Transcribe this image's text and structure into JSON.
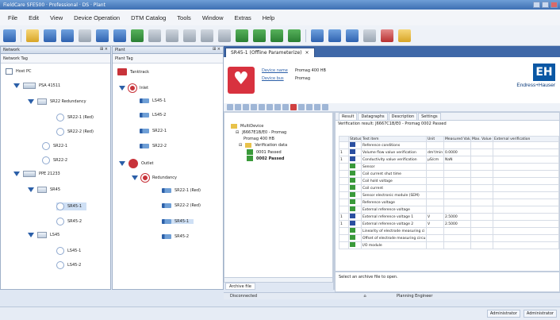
{
  "window": {
    "title": "FieldCare SFE500 · Professional · DS · Plant"
  },
  "menu": [
    "File",
    "Edit",
    "View",
    "Device Operation",
    "DTM Catalog",
    "Tools",
    "Window",
    "Extras",
    "Help"
  ],
  "network_panel": {
    "title": "Network",
    "pin": "⊞ ×",
    "column": "Network Tag",
    "items": [
      "Host PC",
      "PSA 41511",
      "SR22 Redundancy",
      "SR22-1 (Red)",
      "SR22-2 (Red)",
      "SR22-1",
      "SR22-2",
      "PPE 21233",
      "SR45",
      "SR45-1",
      "SR45-2",
      "LS45",
      "LS45-1",
      "LS45-2"
    ]
  },
  "plant_panel": {
    "title": "Plant",
    "pin": "⊞ ×",
    "column": "Plant Tag",
    "items": [
      "Tanktrack",
      "Inlet",
      "LS45-1",
      "LS45-2",
      "SR22-1",
      "SR22-2",
      "Outlet",
      "Redundancy",
      "SR22-1 (Red)",
      "SR22-2 (Red)",
      "SR45-1",
      "SR45-2"
    ]
  },
  "tab": {
    "label": "SR45-1 (Offline Parameterize)",
    "close": "×"
  },
  "device": {
    "name_label": "Device name",
    "name_value": "Promag 400 HB",
    "bus_label": "Device bus",
    "bus_value": "Promag",
    "brand_logo": "EH",
    "brand": "Endress+Hauser"
  },
  "left_tree": {
    "items": [
      "MultiDevice",
      "J6667E1B/E0 - Promag",
      "Promag 400 HB",
      "Verification data",
      "0001 Passed",
      "0002 Passed"
    ],
    "archive_tab": "Archive file"
  },
  "result": {
    "tabs": [
      "Result",
      "Datagraphs",
      "Description",
      "Settings"
    ],
    "verification": "Verification result: J6667C1B/E0 - Promag 0002 Passed",
    "columns": [
      "",
      "Status",
      "Test item",
      "Unit",
      "Measured Value",
      "Max. Value",
      "External verification"
    ],
    "rows": [
      {
        "n": "",
        "s": "b",
        "item": "Reference conditions",
        "unit": "",
        "mv": ""
      },
      {
        "n": "1",
        "s": "b",
        "item": "Volume flow value verification",
        "unit": "dm³/min",
        "mv": "0.0000"
      },
      {
        "n": "1",
        "s": "b",
        "item": "Conductivity value verification",
        "unit": "µS/cm",
        "mv": "NaN"
      },
      {
        "n": "",
        "s": "g",
        "item": "Sensor",
        "unit": "",
        "mv": ""
      },
      {
        "n": "",
        "s": "g",
        "item": "Coil current shut time",
        "unit": "",
        "mv": ""
      },
      {
        "n": "",
        "s": "g",
        "item": "Coil hold voltage",
        "unit": "",
        "mv": ""
      },
      {
        "n": "",
        "s": "g",
        "item": "Coil current",
        "unit": "",
        "mv": ""
      },
      {
        "n": "",
        "s": "g",
        "item": "Sensor electronic module (SEM)",
        "unit": "",
        "mv": ""
      },
      {
        "n": "",
        "s": "g",
        "item": "Reference voltage",
        "unit": "",
        "mv": ""
      },
      {
        "n": "",
        "s": "g",
        "item": "External reference voltage",
        "unit": "",
        "mv": ""
      },
      {
        "n": "1",
        "s": "b",
        "item": "External reference voltage 1",
        "unit": "V",
        "mv": "2.5000"
      },
      {
        "n": "1",
        "s": "b",
        "item": "External reference voltage 2",
        "unit": "V",
        "mv": "2.5000"
      },
      {
        "n": "",
        "s": "g",
        "item": "Linearity of electrode measuring ci",
        "unit": "",
        "mv": ""
      },
      {
        "n": "",
        "s": "g",
        "item": "Offset of electrode measuring circu",
        "unit": "",
        "mv": ""
      },
      {
        "n": "",
        "s": "g",
        "item": "I/O module",
        "unit": "",
        "mv": ""
      }
    ],
    "message": "Select an archive file to open."
  },
  "center_status": {
    "left": "Disconnected",
    "right": "Planning Engineer"
  },
  "statusbar": {
    "role1": "Administrator",
    "role2": "Administrator"
  }
}
